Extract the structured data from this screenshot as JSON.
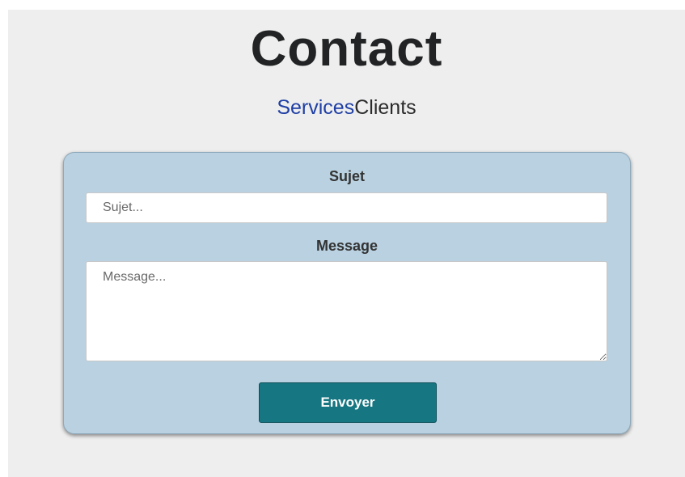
{
  "header": {
    "title": "Contact"
  },
  "nav": {
    "items": [
      {
        "label": "Services"
      },
      {
        "label": "Clients"
      }
    ]
  },
  "form": {
    "subject_label": "Sujet",
    "subject_placeholder": "Sujet...",
    "subject_value": "",
    "message_label": "Message",
    "message_placeholder": "Message...",
    "message_value": "",
    "submit_label": "Envoyer"
  },
  "colors": {
    "page_background": "#eeeeee",
    "card_background": "#b9d1e0",
    "button_background": "#167681",
    "nav_link": "#1f3fa5",
    "title_text": "#222324"
  }
}
